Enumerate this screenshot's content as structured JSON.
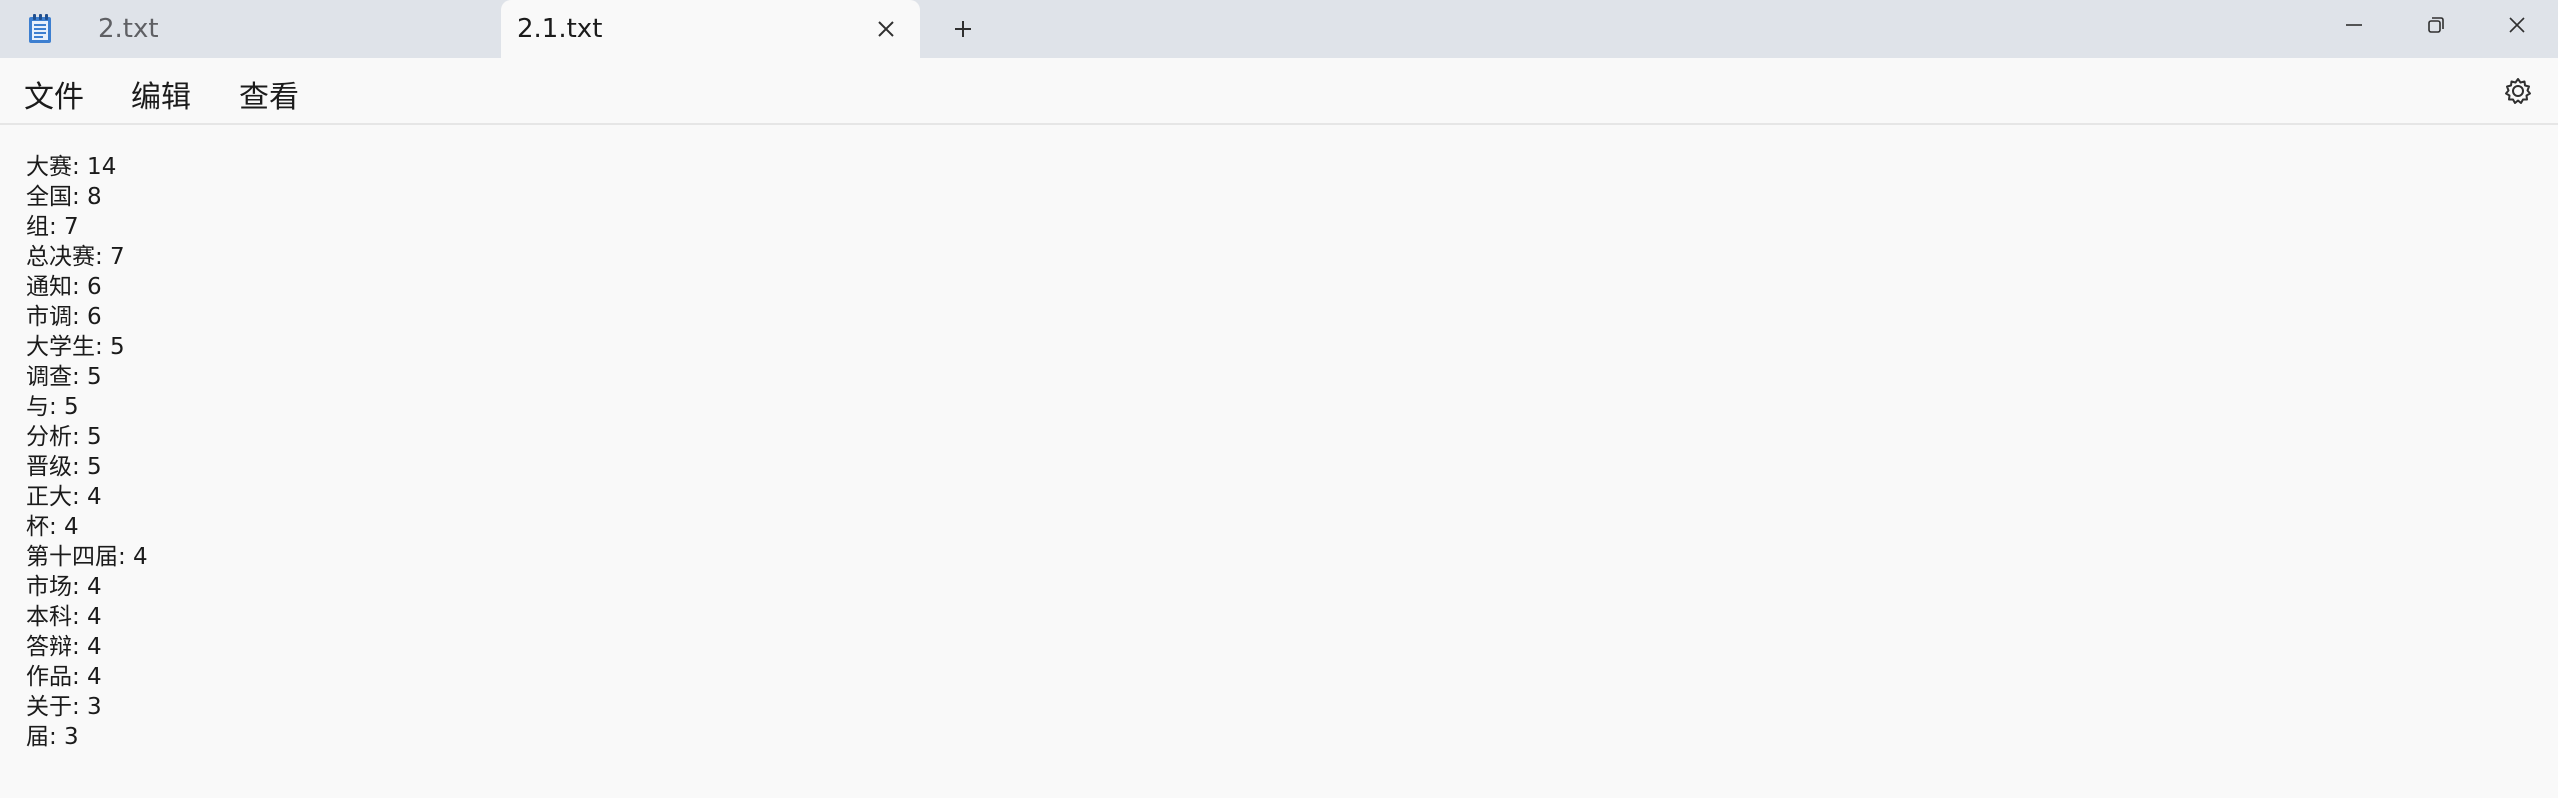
{
  "titlebar": {
    "app_icon": "notepad-icon",
    "tabs": [
      {
        "label": "2.txt",
        "active": false
      },
      {
        "label": "2.1.txt",
        "active": true
      }
    ],
    "close_tab_icon": "close-icon",
    "new_tab_icon": "plus-icon",
    "window_controls": [
      "minimize-icon",
      "restore-icon",
      "close-icon"
    ]
  },
  "menubar": {
    "items": [
      "文件",
      "编辑",
      "查看"
    ],
    "settings_icon": "gear-icon"
  },
  "editor": {
    "lines": [
      "大赛: 14",
      "全国: 8",
      "组: 7",
      "总决赛: 7",
      "通知: 6",
      "市调: 6",
      "大学生: 5",
      "调查: 5",
      "与: 5",
      "分析: 5",
      "晋级: 5",
      "正大: 4",
      "杯: 4",
      "第十四届: 4",
      "市场: 4",
      "本科: 4",
      "答辩: 4",
      "作品: 4",
      "关于: 3",
      "届: 3"
    ]
  },
  "colors": {
    "titlebar_bg": "#dfe3e9",
    "content_bg": "#f9f9f9",
    "text": "#1b1b1b",
    "inactive_tab_text": "#5f6064"
  }
}
